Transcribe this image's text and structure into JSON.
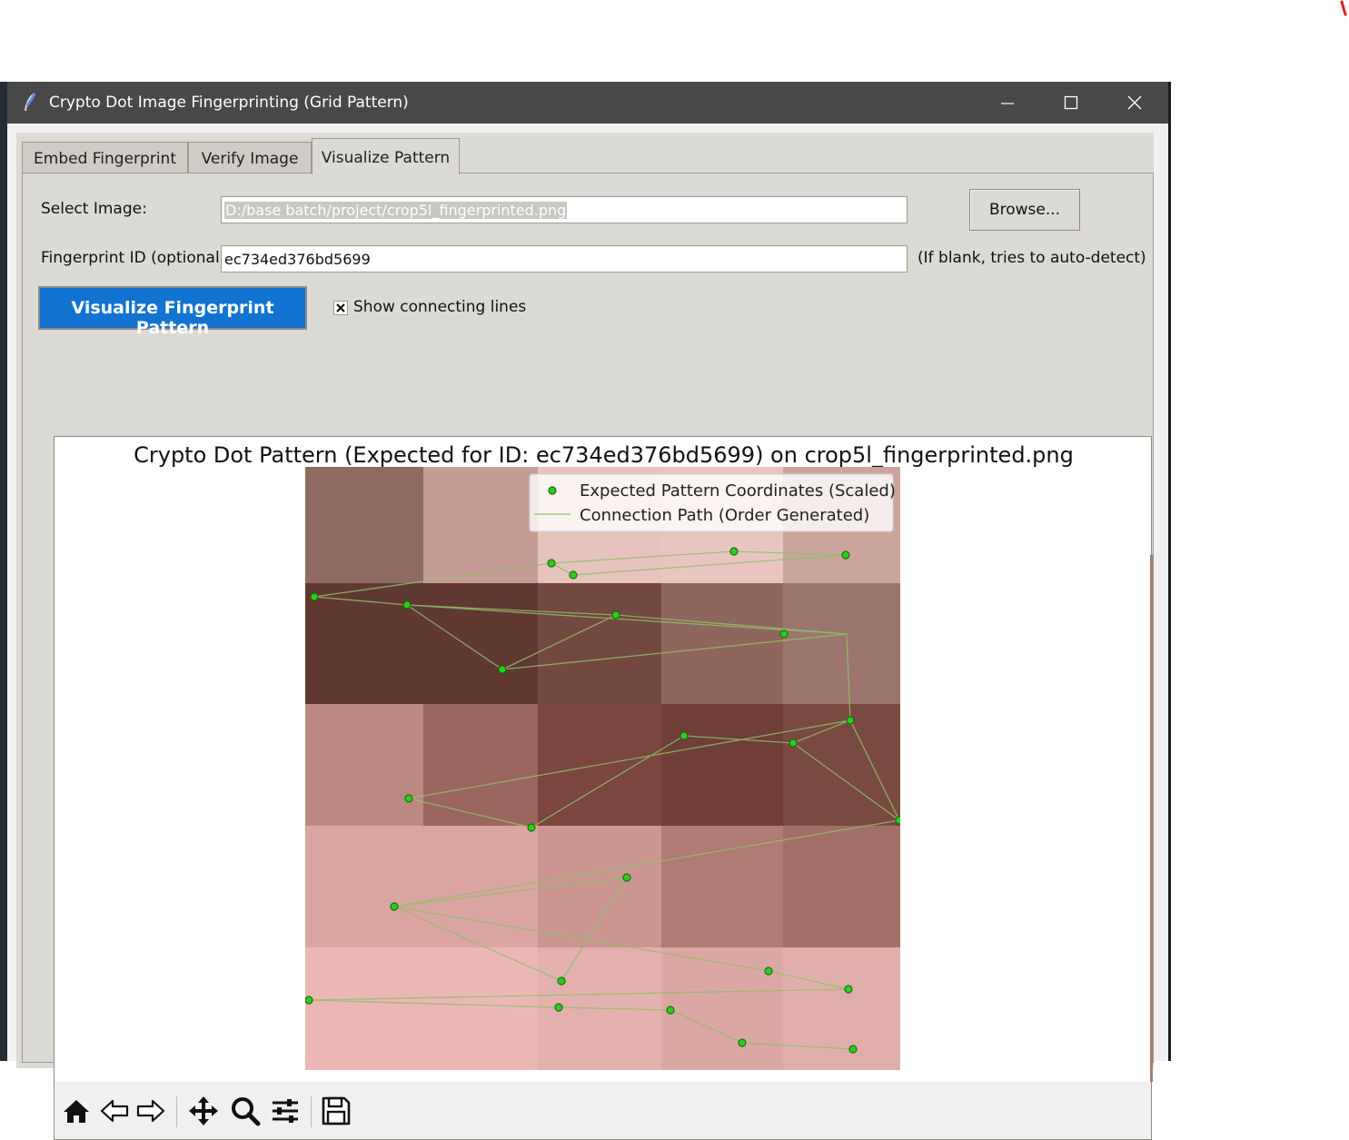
{
  "window": {
    "title": "Crypto Dot Image Fingerprinting (Grid Pattern)",
    "minimize_label": "—",
    "maximize_label": "☐",
    "close_label": "✕"
  },
  "tabs": [
    {
      "label": "Embed Fingerprint",
      "active": false
    },
    {
      "label": "Verify Image",
      "active": false
    },
    {
      "label": "Visualize Pattern",
      "active": true
    }
  ],
  "form": {
    "select_image_label": "Select Image:",
    "image_path": "D:/base batch/project/crop5l_fingerprinted.png",
    "browse_label": "Browse...",
    "fingerprint_label": "Fingerprint ID (optional):",
    "fingerprint_value": "ec734ed376bd5699",
    "fingerprint_hint": "(If blank, tries to auto-detect)",
    "visualize_button": "Visualize Fingerprint Pattern",
    "show_lines_label": "Show connecting lines",
    "show_lines_checked": true
  },
  "figure": {
    "title": "Crypto Dot Pattern (Expected for ID: ec734ed376bd5699) on crop5l_fingerprinted.png",
    "legend": {
      "points_label": "Expected Pattern Coordinates (Scaled)",
      "path_label": "Connection Path (Order Generated)"
    }
  },
  "colors": {
    "accent_button": "#1373d0",
    "point_color": "#2ecc1f",
    "path_color": "#8fbf6a"
  },
  "toolbar": {
    "icons": [
      "home-icon",
      "back-icon",
      "forward-icon",
      "pan-icon",
      "zoom-icon",
      "configure-subplots-icon",
      "save-icon"
    ]
  }
}
